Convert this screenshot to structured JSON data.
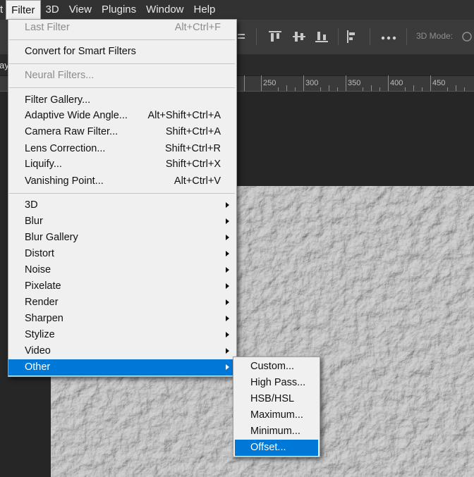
{
  "menubar": {
    "items": [
      {
        "label": "t",
        "active": false
      },
      {
        "label": "Filter",
        "active": true
      },
      {
        "label": "3D",
        "active": false
      },
      {
        "label": "View",
        "active": false
      },
      {
        "label": "Plugins",
        "active": false
      },
      {
        "label": "Window",
        "active": false
      },
      {
        "label": "Help",
        "active": false
      }
    ]
  },
  "optionsbar": {
    "mode_label": "3D Mode:",
    "more_icon": "ellipsis-icon"
  },
  "doctab": {
    "fragment": "ay"
  },
  "ruler": {
    "labels": [
      "250",
      "300",
      "350",
      "400",
      "450"
    ]
  },
  "filter_menu": {
    "last_filter": {
      "label": "Last Filter",
      "shortcut": "Alt+Ctrl+F"
    },
    "convert": {
      "label": "Convert for Smart Filters"
    },
    "neural": {
      "label": "Neural Filters..."
    },
    "filter_gallery": {
      "label": "Filter Gallery..."
    },
    "adaptive": {
      "label": "Adaptive Wide Angle...",
      "shortcut": "Alt+Shift+Ctrl+A"
    },
    "camera_raw": {
      "label": "Camera Raw Filter...",
      "shortcut": "Shift+Ctrl+A"
    },
    "lens": {
      "label": "Lens Correction...",
      "shortcut": "Shift+Ctrl+R"
    },
    "liquify": {
      "label": "Liquify...",
      "shortcut": "Shift+Ctrl+X"
    },
    "vanishing": {
      "label": "Vanishing Point...",
      "shortcut": "Alt+Ctrl+V"
    },
    "submenus": [
      "3D",
      "Blur",
      "Blur Gallery",
      "Distort",
      "Noise",
      "Pixelate",
      "Render",
      "Sharpen",
      "Stylize",
      "Video",
      "Other"
    ]
  },
  "other_submenu": {
    "items": [
      "Custom...",
      "High Pass...",
      "HSB/HSL",
      "Maximum...",
      "Minimum...",
      "Offset..."
    ]
  },
  "colors": {
    "highlight": "#0078d7",
    "menu_bg": "#f0f0f0",
    "app_bg": "#262626"
  }
}
